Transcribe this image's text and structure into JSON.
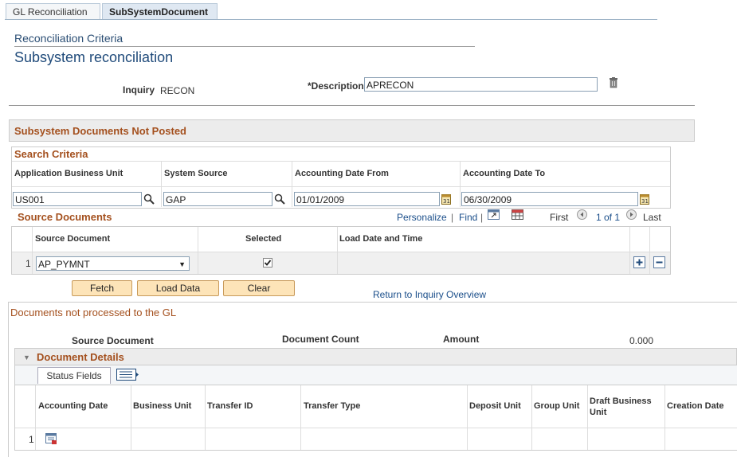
{
  "tabs": [
    {
      "label": "GL Reconciliation"
    },
    {
      "label": "SubSystemDocument"
    }
  ],
  "header": {
    "criteria_label": "Reconciliation Criteria",
    "page_title": "Subsystem reconciliation"
  },
  "inquiry": {
    "label": "Inquiry",
    "value": "RECON"
  },
  "description": {
    "label": "*Description",
    "value": "APRECON"
  },
  "not_posted_section": {
    "title": "Subsystem Documents Not Posted"
  },
  "search_criteria": {
    "title": "Search Criteria",
    "columns": [
      "Application Business Unit",
      "System Source",
      "Accounting Date From",
      "Accounting Date To"
    ],
    "values": {
      "business_unit": "US001",
      "system_source": "GAP",
      "date_from": "01/01/2009",
      "date_to": "06/30/2009"
    }
  },
  "source_documents": {
    "title": "Source Documents",
    "personalize": "Personalize",
    "find": "Find",
    "first": "First",
    "range": "1 of 1",
    "last": "Last",
    "columns": [
      "Source Document",
      "Selected",
      "Load Date and Time"
    ],
    "rows": [
      {
        "num": "1",
        "source_document": "AP_PYMNT",
        "selected": true,
        "load_date": ""
      }
    ]
  },
  "buttons": {
    "fetch": "Fetch",
    "load_data": "Load Data",
    "clear": "Clear"
  },
  "return_link": "Return to Inquiry Overview",
  "not_processed": {
    "title": "Documents not processed to the GL",
    "source_document_label": "Source Document",
    "document_count_label": "Document Count",
    "amount_label": "Amount",
    "amount_value": "0.000"
  },
  "document_details": {
    "title": "Document Details",
    "tab_label": "Status Fields",
    "columns": [
      "Accounting Date",
      "Business Unit",
      "Transfer ID",
      "Transfer Type",
      "Deposit Unit",
      "Group Unit",
      "Draft Business Unit",
      "Creation Date"
    ],
    "rows": [
      {
        "num": "1"
      }
    ]
  },
  "colors": {
    "accent": "#a4501e",
    "title_blue": "#1f4a7a",
    "link": "#1a4e8a",
    "button_bg": "#fde4b8"
  }
}
